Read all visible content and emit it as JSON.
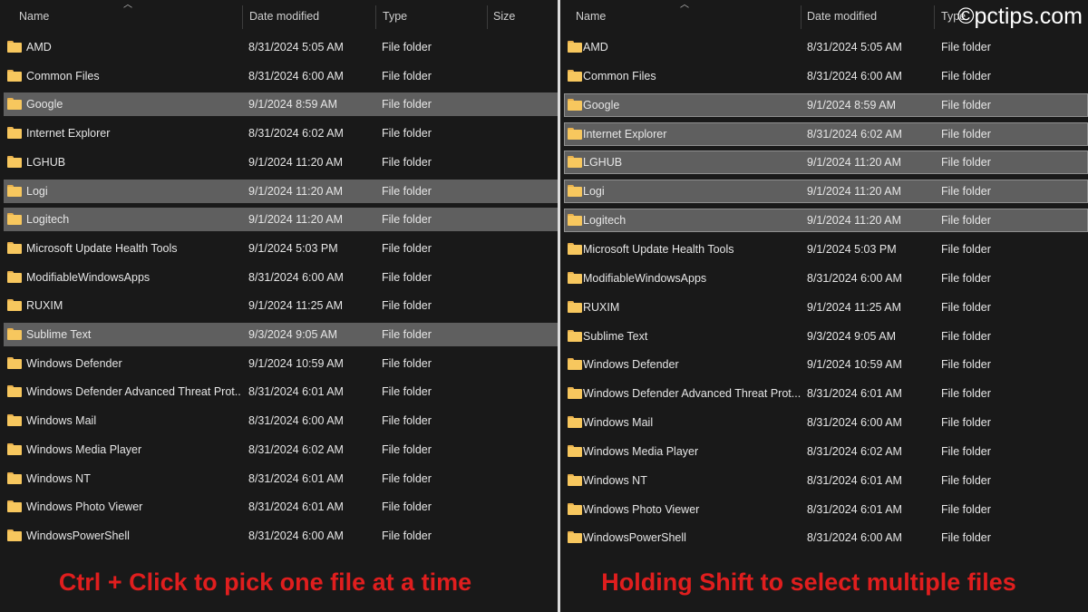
{
  "columns": {
    "name": "Name",
    "date": "Date modified",
    "type": "Type",
    "size": "Size"
  },
  "watermark": "©pctips.com",
  "left": {
    "caption": "Ctrl + Click to pick one file at a time",
    "rows": [
      {
        "name": "AMD",
        "date": "8/31/2024 5:05 AM",
        "type": "File folder",
        "selected": false
      },
      {
        "name": "Common Files",
        "date": "8/31/2024 6:00 AM",
        "type": "File folder",
        "selected": false
      },
      {
        "name": "Google",
        "date": "9/1/2024 8:59 AM",
        "type": "File folder",
        "selected": true
      },
      {
        "name": "Internet Explorer",
        "date": "8/31/2024 6:02 AM",
        "type": "File folder",
        "selected": false
      },
      {
        "name": "LGHUB",
        "date": "9/1/2024 11:20 AM",
        "type": "File folder",
        "selected": false
      },
      {
        "name": "Logi",
        "date": "9/1/2024 11:20 AM",
        "type": "File folder",
        "selected": true
      },
      {
        "name": "Logitech",
        "date": "9/1/2024 11:20 AM",
        "type": "File folder",
        "selected": true
      },
      {
        "name": "Microsoft Update Health Tools",
        "date": "9/1/2024 5:03 PM",
        "type": "File folder",
        "selected": false
      },
      {
        "name": "ModifiableWindowsApps",
        "date": "8/31/2024 6:00 AM",
        "type": "File folder",
        "selected": false
      },
      {
        "name": "RUXIM",
        "date": "9/1/2024 11:25 AM",
        "type": "File folder",
        "selected": false
      },
      {
        "name": "Sublime Text",
        "date": "9/3/2024 9:05 AM",
        "type": "File folder",
        "selected": true
      },
      {
        "name": "Windows Defender",
        "date": "9/1/2024 10:59 AM",
        "type": "File folder",
        "selected": false
      },
      {
        "name": "Windows Defender Advanced Threat Prot...",
        "date": "8/31/2024 6:01 AM",
        "type": "File folder",
        "selected": false
      },
      {
        "name": "Windows Mail",
        "date": "8/31/2024 6:00 AM",
        "type": "File folder",
        "selected": false
      },
      {
        "name": "Windows Media Player",
        "date": "8/31/2024 6:02 AM",
        "type": "File folder",
        "selected": false
      },
      {
        "name": "Windows NT",
        "date": "8/31/2024 6:01 AM",
        "type": "File folder",
        "selected": false
      },
      {
        "name": "Windows Photo Viewer",
        "date": "8/31/2024 6:01 AM",
        "type": "File folder",
        "selected": false
      },
      {
        "name": "WindowsPowerShell",
        "date": "8/31/2024 6:00 AM",
        "type": "File folder",
        "selected": false
      }
    ]
  },
  "right": {
    "caption": "Holding Shift to select multiple files",
    "rows": [
      {
        "name": "AMD",
        "date": "8/31/2024 5:05 AM",
        "type": "File folder",
        "selected": false
      },
      {
        "name": "Common Files",
        "date": "8/31/2024 6:00 AM",
        "type": "File folder",
        "selected": false
      },
      {
        "name": "Google",
        "date": "9/1/2024 8:59 AM",
        "type": "File folder",
        "selected": true
      },
      {
        "name": "Internet Explorer",
        "date": "8/31/2024 6:02 AM",
        "type": "File folder",
        "selected": true
      },
      {
        "name": "LGHUB",
        "date": "9/1/2024 11:20 AM",
        "type": "File folder",
        "selected": true
      },
      {
        "name": "Logi",
        "date": "9/1/2024 11:20 AM",
        "type": "File folder",
        "selected": true
      },
      {
        "name": "Logitech",
        "date": "9/1/2024 11:20 AM",
        "type": "File folder",
        "selected": true
      },
      {
        "name": "Microsoft Update Health Tools",
        "date": "9/1/2024 5:03 PM",
        "type": "File folder",
        "selected": false
      },
      {
        "name": "ModifiableWindowsApps",
        "date": "8/31/2024 6:00 AM",
        "type": "File folder",
        "selected": false
      },
      {
        "name": "RUXIM",
        "date": "9/1/2024 11:25 AM",
        "type": "File folder",
        "selected": false
      },
      {
        "name": "Sublime Text",
        "date": "9/3/2024 9:05 AM",
        "type": "File folder",
        "selected": false
      },
      {
        "name": "Windows Defender",
        "date": "9/1/2024 10:59 AM",
        "type": "File folder",
        "selected": false
      },
      {
        "name": "Windows Defender Advanced Threat Prot...",
        "date": "8/31/2024 6:01 AM",
        "type": "File folder",
        "selected": false
      },
      {
        "name": "Windows Mail",
        "date": "8/31/2024 6:00 AM",
        "type": "File folder",
        "selected": false
      },
      {
        "name": "Windows Media Player",
        "date": "8/31/2024 6:02 AM",
        "type": "File folder",
        "selected": false
      },
      {
        "name": "Windows NT",
        "date": "8/31/2024 6:01 AM",
        "type": "File folder",
        "selected": false
      },
      {
        "name": "Windows Photo Viewer",
        "date": "8/31/2024 6:01 AM",
        "type": "File folder",
        "selected": false
      },
      {
        "name": "WindowsPowerShell",
        "date": "8/31/2024 6:00 AM",
        "type": "File folder",
        "selected": false
      }
    ]
  }
}
